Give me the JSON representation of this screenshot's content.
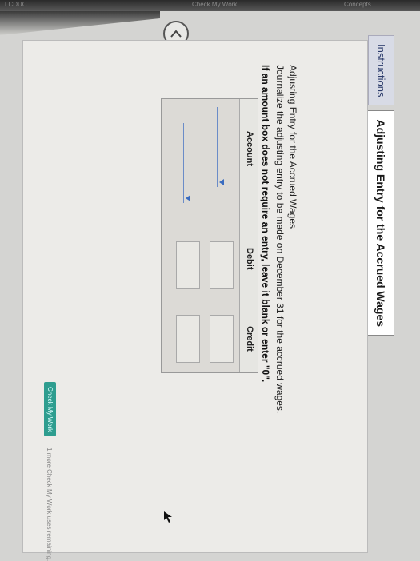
{
  "top_strip": {
    "left_fragment": "LCDUC",
    "center_fragment": "Check My Work",
    "right_fragment": "Concepts"
  },
  "tabs": [
    {
      "label": "Instructions",
      "active": false
    },
    {
      "label": "Adjusting Entry for the Accrued Wages",
      "active": true
    }
  ],
  "panel": {
    "title": "Adjusting Entry for the Accrued Wages",
    "instruction": "Journalize the adjusting entry to be made on December 31 for the accrued wages.",
    "note": "If an amount box does not require an entry, leave it blank or enter \"0\"."
  },
  "journal": {
    "headers": {
      "account": "Account",
      "debit": "Debit",
      "credit": "Credit"
    },
    "rows": [
      {
        "account": "",
        "debit": "",
        "credit": ""
      },
      {
        "account": "",
        "debit": "",
        "credit": ""
      }
    ]
  },
  "footer": {
    "check_button": "Check My Work",
    "attempts_text": "1 more Check My Work uses remaining."
  },
  "colors": {
    "accent": "#2e9d8f",
    "link_blue": "#3a6cc0"
  },
  "icons": [
    "chevron-up-icon",
    "dropdown-caret-icon",
    "mouse-cursor-icon"
  ]
}
